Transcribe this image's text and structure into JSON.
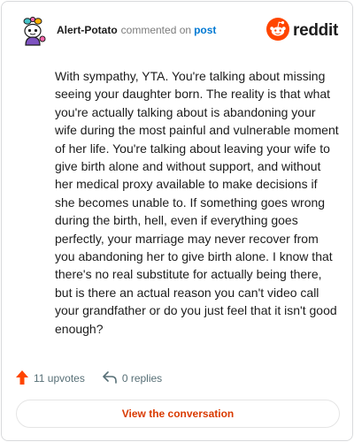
{
  "header": {
    "username": "Alert-Potato",
    "action": "commented on",
    "post_link": "post",
    "logo_text": "reddit"
  },
  "comment": {
    "body": "With sympathy, YTA. You're talking about missing seeing your daughter born. The reality is that what you're actually talking about is abandoning your wife during the most painful and vulnerable moment of her life. You're talking about leaving your wife to give birth alone and without support, and without her medical proxy available to make decisions if she becomes unable to. If something goes wrong during the birth, hell, even if everything goes perfectly, your marriage may never recover from you abandoning her to give birth alone. I know that there's no real substitute for actually being there, but is there an actual reason you can't video call your grandfather or do you just feel that it isn't good enough?"
  },
  "footer": {
    "upvotes": "11 upvotes",
    "replies": "0 replies",
    "view_button": "View the conversation"
  },
  "icons": {
    "avatar": "avatar-icon",
    "logo": "reddit-logo-icon",
    "upvote": "upvote-arrow-icon",
    "reply": "reply-arrow-icon"
  },
  "colors": {
    "brand": "#ff4500",
    "link": "#0079d3",
    "button_text": "#d93a00",
    "border": "#d9dadc"
  }
}
